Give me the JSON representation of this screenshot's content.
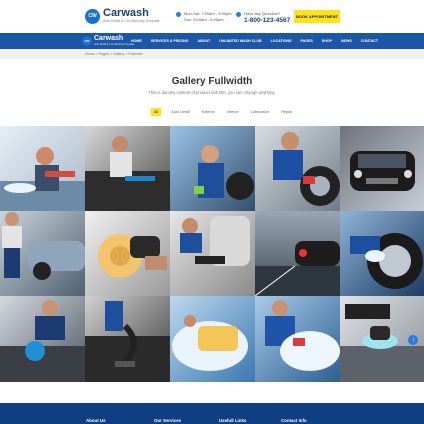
{
  "header": {
    "logo_title": "Carwash",
    "logo_sub": "Auto Detail & Car Washing Template",
    "logo_badge": "CW",
    "hours_line1": "Mon-Sat: 7:00am - 9:00pm",
    "hours_line2": "Sun: 8:00am - 6:00pm",
    "question": "Have any Question?",
    "phone": "1-800-123-4567",
    "appointment_button": "BOOK APPOINTMENT"
  },
  "nav": {
    "logo_title": "Carwash",
    "logo_sub": "Auto Detail & Car Washing Template",
    "items": [
      "HOME",
      "SERVICES & PRICING",
      "ABOUT",
      "UNLIMITED WASH CLUB",
      "LOCATIONS",
      "PAGES",
      "SHOP",
      "NEWS",
      "CONTACT"
    ]
  },
  "breadcrumb": "Home  >  Pages  >  Gallery  >  Fullwidth",
  "page": {
    "title": "Gallery Fullwidth",
    "subtitle": "This is dummy content of product sub title, you can change anything."
  },
  "filters": [
    "All",
    "Auto Detail",
    "Exterior",
    "Interior",
    "Lubrication",
    "Repair"
  ],
  "active_filter": "All",
  "footer": {
    "headings": [
      "About Us",
      "Our Services",
      "Usefull Links",
      "Contact Info"
    ]
  },
  "colors": {
    "brand_blue": "#1b56a8",
    "accent_yellow": "#ffe31a",
    "footer_blue": "#0d3f82"
  },
  "gallery_icons": [
    "car-wash-photo",
    "interior-vacuum-photo",
    "mechanic-wheel-photo",
    "wheel-cleaning-photo",
    "black-car-photo",
    "garage-mechanic-photo",
    "polisher-photo",
    "seat-vacuum-photo",
    "red-car-night-photo",
    "rim-washing-photo",
    "dashboard-polish-photo",
    "vacuum-hose-photo",
    "sponge-foam-photo",
    "foam-wash-photo",
    "buffer-polish-photo"
  ]
}
